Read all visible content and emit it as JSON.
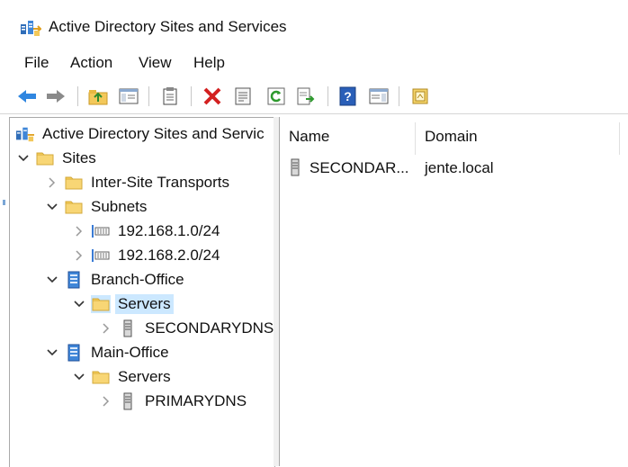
{
  "window": {
    "title": "Active Directory Sites and Services",
    "icon": "ad-sites-icon"
  },
  "menu": [
    "File",
    "Action",
    "View",
    "Help"
  ],
  "toolbar": {
    "buttons": [
      "back-icon",
      "forward-icon",
      "up-folder-icon",
      "show-hide-tree-icon",
      "copy-icon",
      "delete-icon",
      "properties-icon",
      "refresh-icon",
      "export-list-icon",
      "help-icon",
      "action-pane-icon",
      "mmc-icon"
    ]
  },
  "tree": {
    "root": "Active Directory Sites and Servic",
    "sites": "Sites",
    "inter_site": "Inter-Site Transports",
    "subnets": "Subnets",
    "subnet1": "192.168.1.0/24",
    "subnet2": "192.168.2.0/24",
    "branch": "Branch-Office",
    "branch_servers": "Servers",
    "secondary": "SECONDARYDNS",
    "main": "Main-Office",
    "main_servers": "Servers",
    "primary": "PRIMARYDNS"
  },
  "list": {
    "columns": [
      "Name",
      "Domain"
    ],
    "rows": [
      {
        "name": "SECONDAR...",
        "domain": "jente.local"
      }
    ]
  },
  "colors": {
    "selection": "#cce8ff",
    "folder": "#f3c85a",
    "server_blue": "#3a7bd5"
  }
}
